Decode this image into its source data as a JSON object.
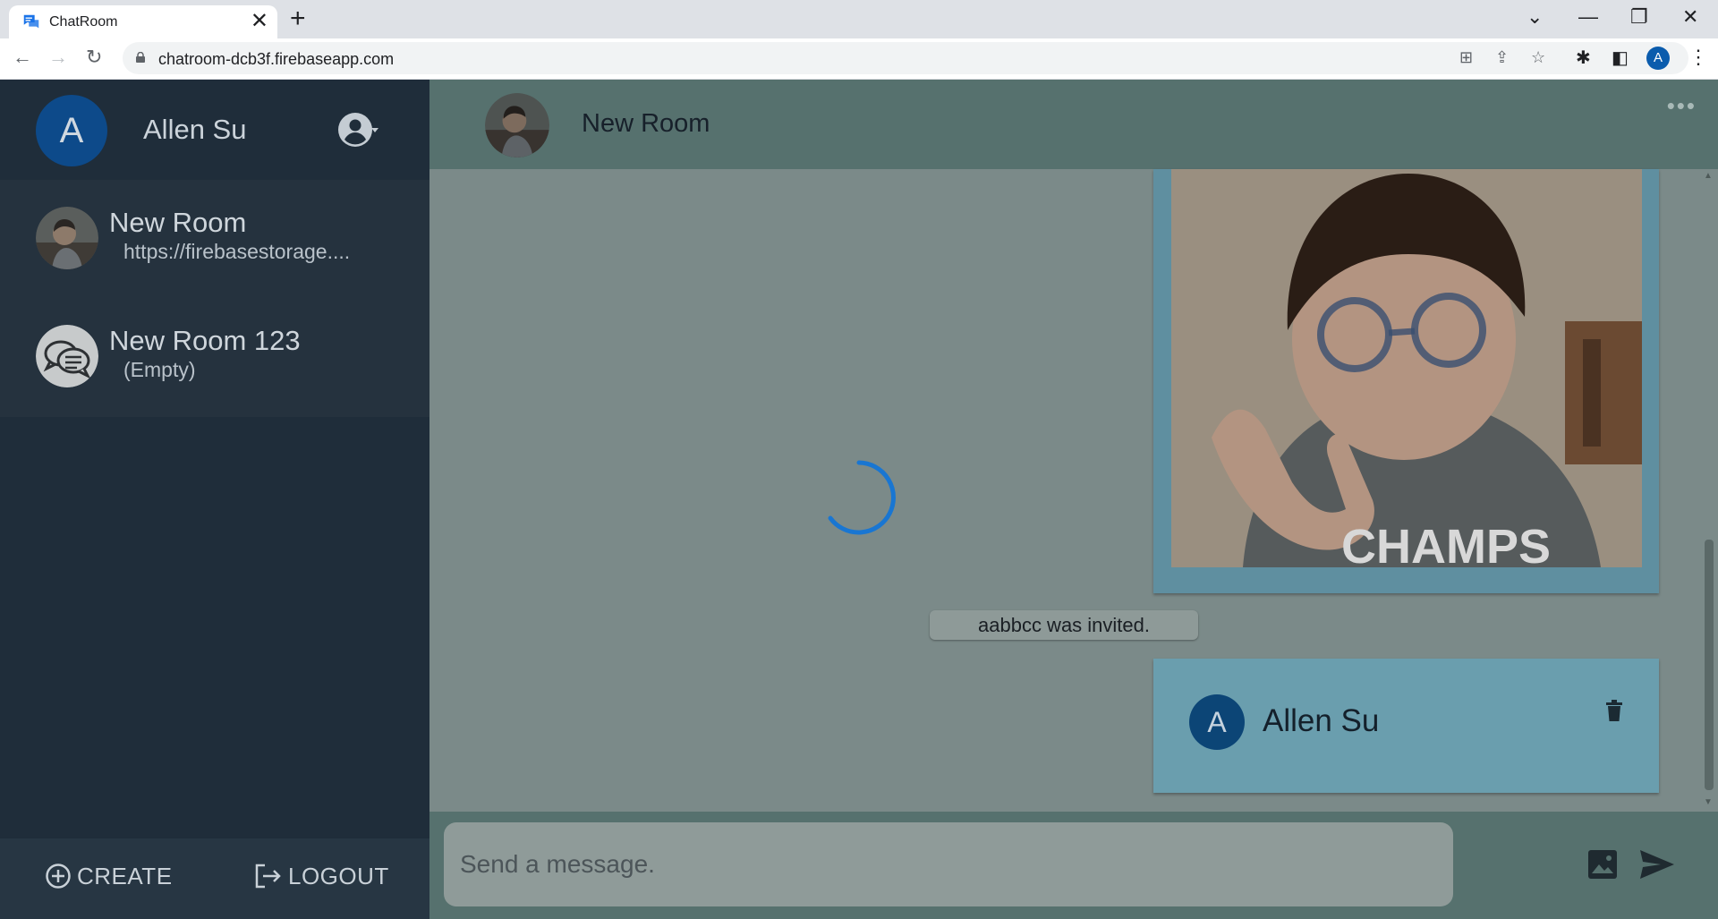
{
  "browser": {
    "tab_title": "ChatRoom",
    "tab_close": "✕",
    "new_tab": "+",
    "url": "chatroom-dcb3f.firebaseapp.com",
    "profile_initial": "A"
  },
  "sidebar": {
    "user": {
      "initial": "A",
      "name": "Allen Su"
    },
    "rooms": [
      {
        "name": "New Room",
        "preview": "https://firebasestorage...."
      },
      {
        "name": "New Room 123",
        "preview": "(Empty)"
      }
    ],
    "footer": {
      "create_label": "CREATE",
      "logout_label": "LOGOUT"
    }
  },
  "chat": {
    "header": {
      "title": "New Room",
      "more": "•••"
    },
    "system_message": "aabbcc was invited.",
    "message": {
      "initial": "A",
      "sender": "Allen Su"
    },
    "photo_caption": "CHAMPS",
    "composer": {
      "placeholder": "Send a message."
    }
  },
  "colors": {
    "sidebar_bg": "#1f2d3a",
    "chat_bg": "#7b8a89",
    "header_bg": "#56716e",
    "spinner": "#1976d2",
    "avatar_blue": "#0d4a8a"
  }
}
